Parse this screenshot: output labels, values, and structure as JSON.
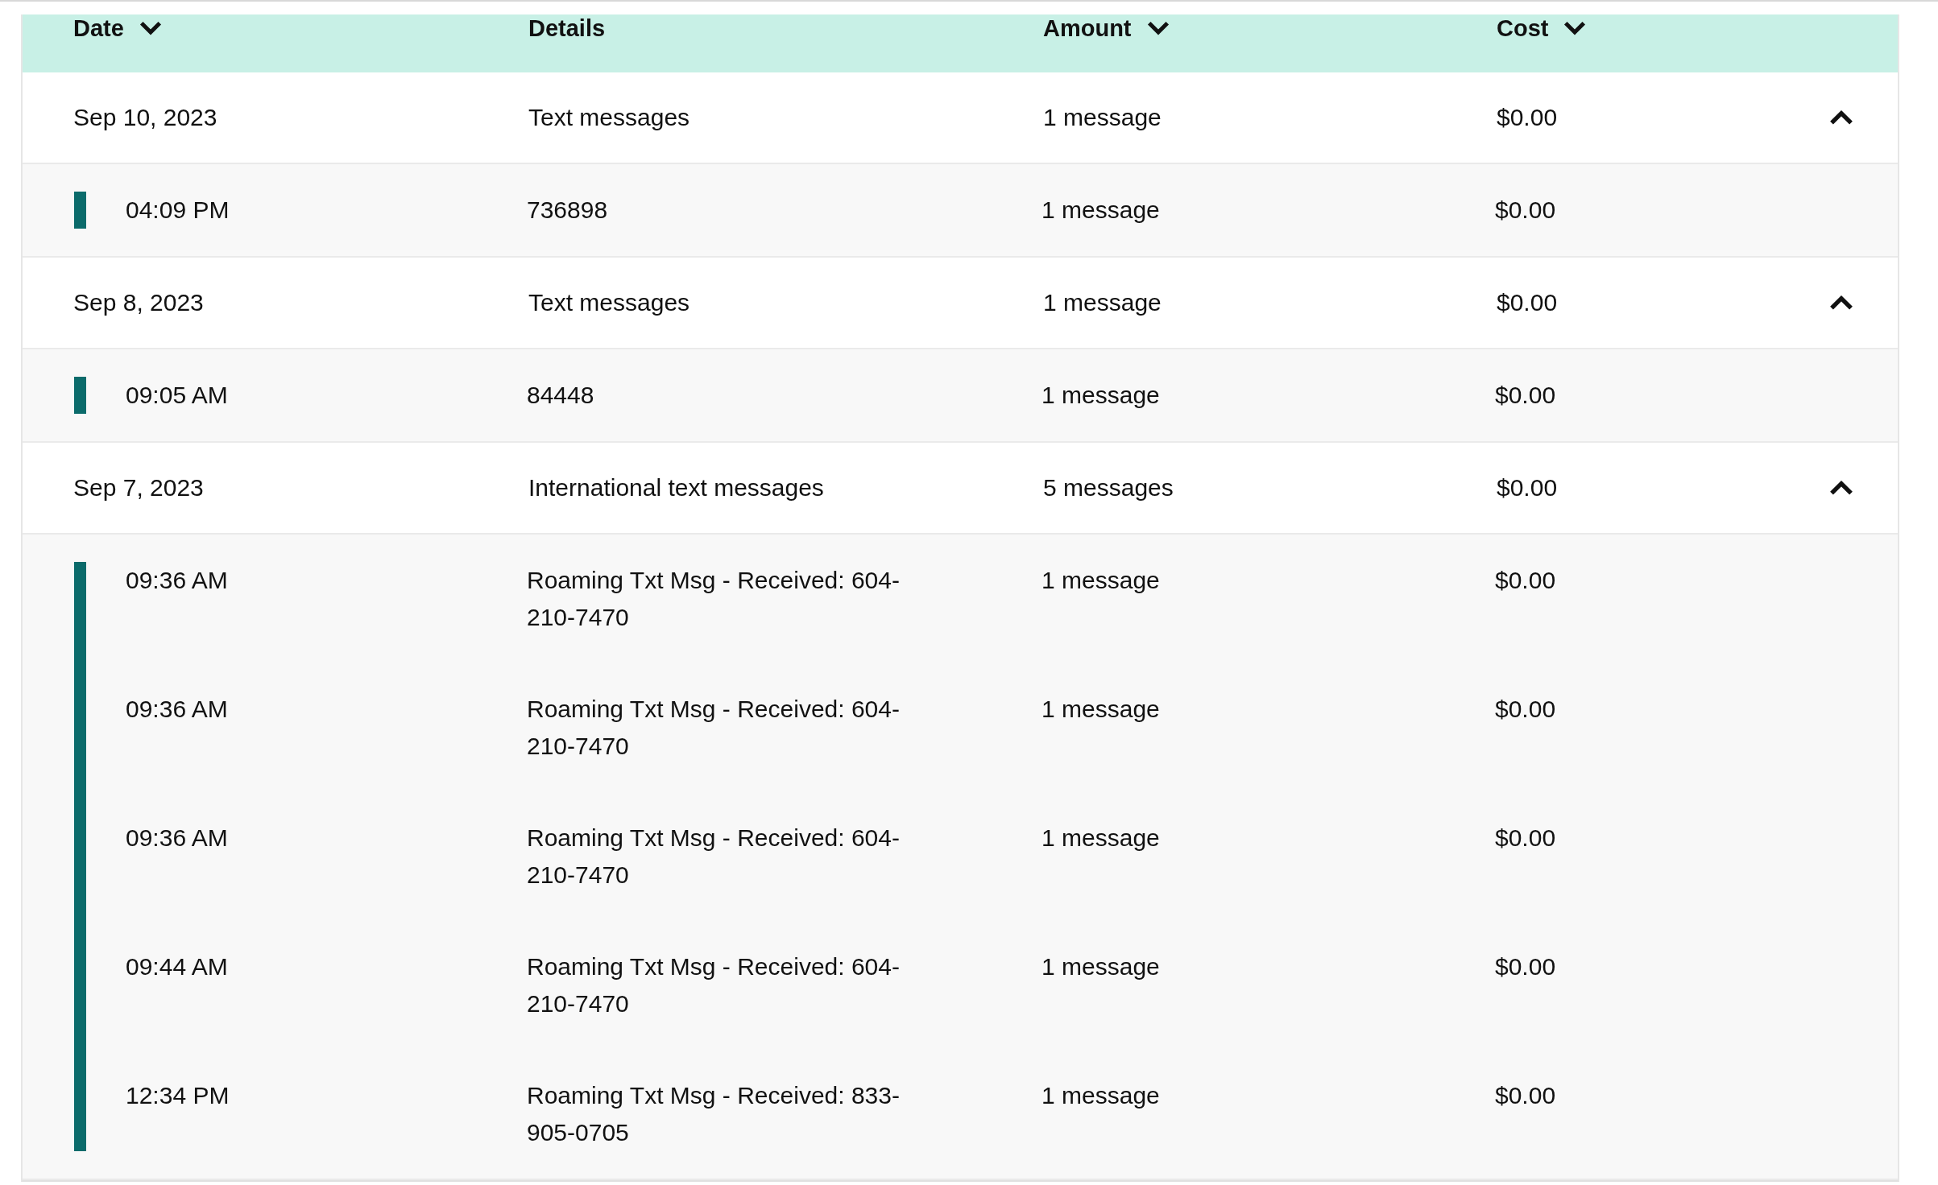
{
  "columns": [
    {
      "label": "Date",
      "sortable": true
    },
    {
      "label": "Details",
      "sortable": false
    },
    {
      "label": "Amount",
      "sortable": true
    },
    {
      "label": "Cost",
      "sortable": true
    }
  ],
  "groups": [
    {
      "date": "Sep 10, 2023",
      "details": "Text messages",
      "amount": "1 message",
      "cost": "$0.00",
      "expanded": true,
      "items": [
        {
          "time": "04:09 PM",
          "details": "736898",
          "amount": "1 message",
          "cost": "$0.00"
        }
      ]
    },
    {
      "date": "Sep 8, 2023",
      "details": "Text messages",
      "amount": "1 message",
      "cost": "$0.00",
      "expanded": true,
      "items": [
        {
          "time": "09:05 AM",
          "details": "84448",
          "amount": "1 message",
          "cost": "$0.00"
        }
      ]
    },
    {
      "date": "Sep 7, 2023",
      "details": "International text messages",
      "amount": "5 messages",
      "cost": "$0.00",
      "expanded": true,
      "items": [
        {
          "time": "09:36 AM",
          "details": "Roaming Txt Msg - Received: 604-210-7470",
          "amount": "1 message",
          "cost": "$0.00"
        },
        {
          "time": "09:36 AM",
          "details": "Roaming Txt Msg - Received: 604-210-7470",
          "amount": "1 message",
          "cost": "$0.00"
        },
        {
          "time": "09:36 AM",
          "details": "Roaming Txt Msg - Received: 604-210-7470",
          "amount": "1 message",
          "cost": "$0.00"
        },
        {
          "time": "09:44 AM",
          "details": "Roaming Txt Msg - Received: 604-210-7470",
          "amount": "1 message",
          "cost": "$0.00"
        },
        {
          "time": "12:34 PM",
          "details": "Roaming Txt Msg - Received: 833-905-0705",
          "amount": "1 message",
          "cost": "$0.00"
        }
      ]
    }
  ]
}
